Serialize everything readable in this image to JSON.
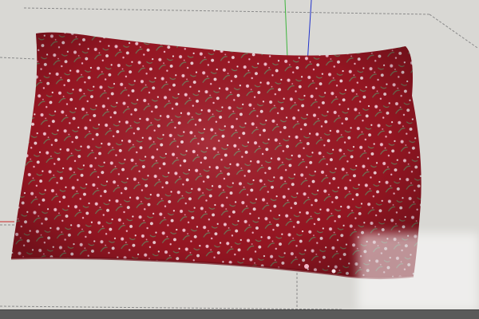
{
  "scene": {
    "object": "pillow-model",
    "fabric": "red-floral-pattern",
    "colors": {
      "background": "#d9d8d4",
      "pillow_base": "#9c1724",
      "pillow_shadow": "#6e0d17",
      "flower_pink": "#f2b6c7",
      "flower_white": "#f7e6ea",
      "leaf_green": "#6f7a5a",
      "axis_green": "#3db53d",
      "axis_blue": "#2233cc",
      "axis_red": "#cc2a2a",
      "guide_line": "#8a8a8a",
      "status_bar": "#5a5a5a"
    },
    "axes": {
      "green_axis": "green-axis",
      "blue_axis": "blue-axis"
    }
  }
}
